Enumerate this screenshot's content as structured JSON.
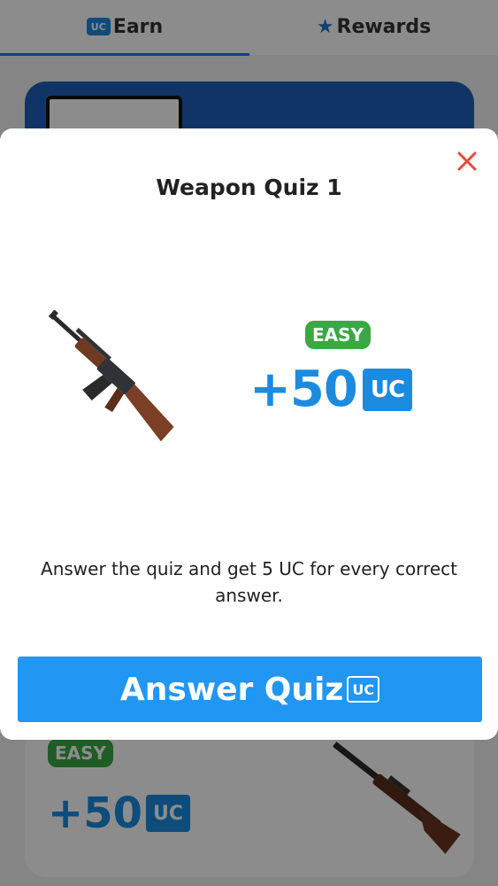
{
  "tabs": {
    "earn_label": "Earn",
    "rewards_label": "Rewards",
    "uc_badge": "UC"
  },
  "background_card": {
    "difficulty": "EASY",
    "reward": "+50",
    "reward_unit": "UC"
  },
  "modal": {
    "title": "Weapon Quiz 1",
    "difficulty": "EASY",
    "reward": "+50",
    "reward_unit": "UC",
    "description": "Answer the quiz and get 5 UC for every correct answer.",
    "button_label": "Answer Quiz",
    "button_unit": "UC"
  },
  "colors": {
    "primary": "#2196f3",
    "uc_blue": "#1b8be0",
    "easy_green": "#3aa845",
    "close_red": "#e64a3b",
    "banner_blue": "#1e5fb8"
  },
  "icons": {
    "close": "close-icon",
    "star": "star-icon",
    "rifle": "assault-rifle-icon",
    "bolt_rifle": "bolt-rifle-icon"
  }
}
